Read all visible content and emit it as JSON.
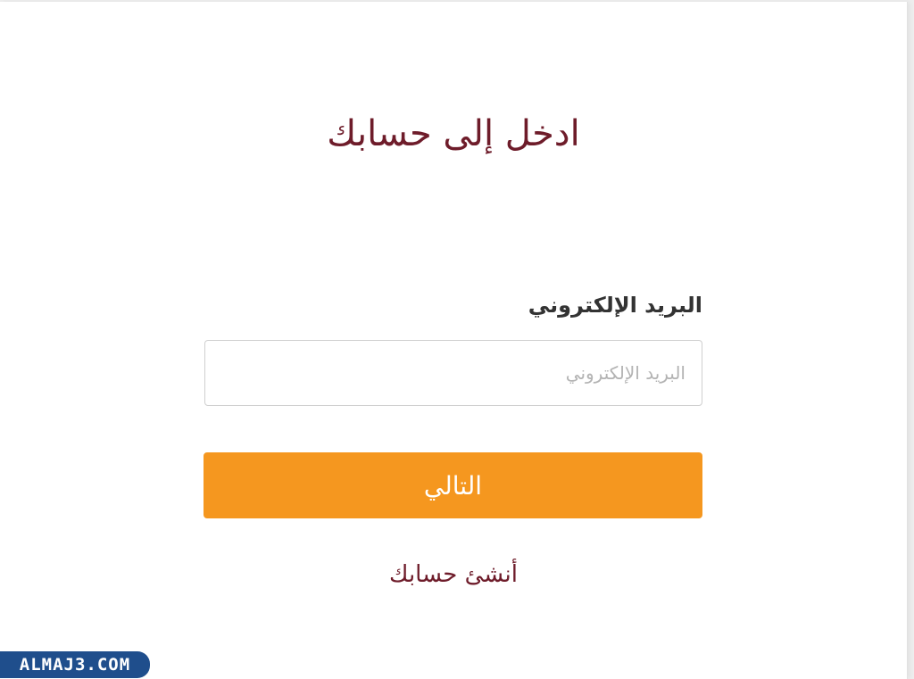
{
  "login": {
    "title": "ادخل إلى حسابك",
    "email_label": "البريد الإلكتروني",
    "email_placeholder": "البريد الإلكتروني",
    "email_value": "",
    "next_button_label": "التالي",
    "create_account_link": "أنشئ حسابك"
  },
  "watermark": {
    "text": "ALMAJ3.COM"
  },
  "colors": {
    "title": "#6e1c2a",
    "button": "#f5971f",
    "link": "#6e1c2a",
    "watermark_bg": "#1f4e8c"
  }
}
